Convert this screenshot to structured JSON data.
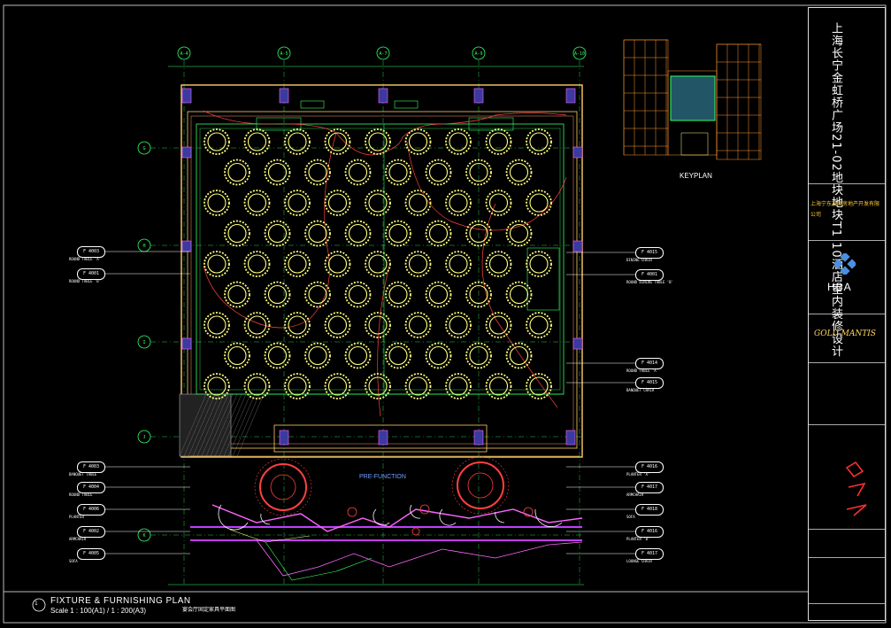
{
  "drawing": {
    "title": "FIXTURE & FURNISHING PLAN",
    "scale": "Scale 1 : 100(A1) / 1 : 200(A3)",
    "title_cn": "宴会厅固定家具平面图",
    "keyplan_label": "KEYPLAN",
    "prefunction_label": "PRE-FUNCTION",
    "project_name_cn": "上海长宁金虹桥广场21-02地块地块T1 10酒店室内装修设计",
    "client_cn": "上海宁东投资房地产开发有限公司",
    "designer_logo": "HBA",
    "contractor_logo": "GOLD MANTIS",
    "number_badge": "1"
  },
  "grid": {
    "columns": [
      "A-4",
      "A-5",
      "A-7",
      "A-9",
      "A-10"
    ],
    "rows": [
      "G",
      "H",
      "I",
      "J",
      "K"
    ]
  },
  "callouts_left": [
    {
      "code": "F 4003",
      "label": "ROUND TABLE 'A'"
    },
    {
      "code": "F 4001",
      "label": "ROUND TABLE 'B'"
    },
    {
      "code": "F 4003",
      "label": "BANQUET TABLE"
    },
    {
      "code": "F 4004",
      "label": "ROUND TABLE"
    },
    {
      "code": "F 4006",
      "label": "PLANTER"
    },
    {
      "code": "F 4002",
      "label": "ARMCHAIR"
    },
    {
      "code": "F 4005",
      "label": "SOFA"
    }
  ],
  "callouts_right": [
    {
      "code": "F 4015",
      "label": "DINING CHAIR"
    },
    {
      "code": "F 4001",
      "label": "ROUND DINING TABLE 'B'"
    },
    {
      "code": "F 4014",
      "label": "ROUND TABLE 'A'"
    },
    {
      "code": "F 4015",
      "label": "BANQUET CHAIR"
    },
    {
      "code": "F 4016",
      "label": "PLANTER 'A'"
    },
    {
      "code": "F 4017",
      "label": "ARMCHAIR"
    },
    {
      "code": "F 4018",
      "label": "SOFA"
    },
    {
      "code": "F 4016",
      "label": "PLANTER 'B'"
    },
    {
      "code": "F 4017",
      "label": "LOUNGE CHAIR"
    }
  ],
  "colors": {
    "table": "#ffff80",
    "wall": "#ffcc66",
    "partition": "#33ff66",
    "boundary": "#ff3333",
    "purple": "#c040ff",
    "accent": "#6fa0ff"
  }
}
